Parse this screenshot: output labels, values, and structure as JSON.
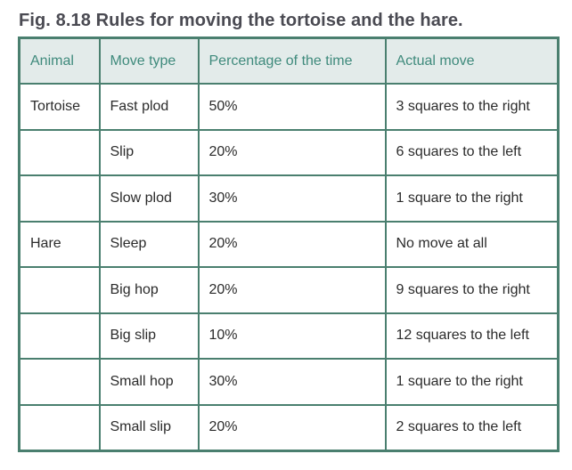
{
  "figure": {
    "title": "Fig. 8.18 Rules for moving the tortoise and the hare."
  },
  "table": {
    "headers": [
      "Animal",
      "Move type",
      "Percentage of the time",
      "Actual move"
    ],
    "rows": [
      {
        "animal": "Tortoise",
        "move_type": "Fast plod",
        "percentage": "50%",
        "actual_move": "3 squares to the right"
      },
      {
        "animal": "",
        "move_type": "Slip",
        "percentage": "20%",
        "actual_move": "6 squares to the left"
      },
      {
        "animal": "",
        "move_type": "Slow plod",
        "percentage": "30%",
        "actual_move": "1 square to the right"
      },
      {
        "animal": "Hare",
        "move_type": "Sleep",
        "percentage": "20%",
        "actual_move": "No move at all"
      },
      {
        "animal": "",
        "move_type": "Big hop",
        "percentage": "20%",
        "actual_move": "9 squares to the right"
      },
      {
        "animal": "",
        "move_type": "Big slip",
        "percentage": "10%",
        "actual_move": "12 squares to the left"
      },
      {
        "animal": "",
        "move_type": "Small hop",
        "percentage": "30%",
        "actual_move": "1 square to the right"
      },
      {
        "animal": "",
        "move_type": "Small slip",
        "percentage": "20%",
        "actual_move": "2 squares to the left"
      }
    ]
  },
  "colors": {
    "border": "#4a7f6f",
    "header_background": "#e3ebea",
    "header_text": "#3f8a7c",
    "title_text": "#4a4a52",
    "body_text": "#2b2b2b"
  }
}
